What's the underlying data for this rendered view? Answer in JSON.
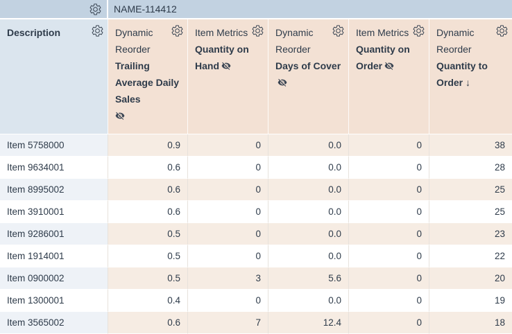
{
  "group_header": {
    "name_label": "NAME-114412"
  },
  "columns": [
    {
      "group": "",
      "label": "Description"
    },
    {
      "group": "Dynamic Reorder",
      "label": "Trailing Average Daily Sales"
    },
    {
      "group": "Item Metrics",
      "label": "Quantity on Hand"
    },
    {
      "group": "Dynamic Reorder",
      "label": "Days of Cover"
    },
    {
      "group": "Item Metrics",
      "label": "Quantity on Order"
    },
    {
      "group": "Dynamic Reorder",
      "label": "Quantity to Order",
      "sort": "↓"
    }
  ],
  "icons": {
    "gear": "settings cog (outline)",
    "visibility-off": "hidden column eye with slash",
    "sort-descending": "↓"
  },
  "rows": [
    {
      "description": "Item 5758000",
      "values": [
        "0.9",
        "0",
        "0.0",
        "0",
        "38"
      ]
    },
    {
      "description": "Item 9634001",
      "values": [
        "0.6",
        "0",
        "0.0",
        "0",
        "28"
      ]
    },
    {
      "description": "Item 8995002",
      "values": [
        "0.6",
        "0",
        "0.0",
        "0",
        "25"
      ]
    },
    {
      "description": "Item 3910001",
      "values": [
        "0.6",
        "0",
        "0.0",
        "0",
        "25"
      ]
    },
    {
      "description": "Item 9286001",
      "values": [
        "0.5",
        "0",
        "0.0",
        "0",
        "23"
      ]
    },
    {
      "description": "Item 1914001",
      "values": [
        "0.5",
        "0",
        "0.0",
        "0",
        "22"
      ]
    },
    {
      "description": "Item 0900002",
      "values": [
        "0.5",
        "3",
        "5.6",
        "0",
        "20"
      ]
    },
    {
      "description": "Item 1300001",
      "values": [
        "0.4",
        "0",
        "0.0",
        "0",
        "19"
      ]
    },
    {
      "description": "Item 3565002",
      "values": [
        "0.6",
        "7",
        "12.4",
        "0",
        "18"
      ]
    }
  ],
  "colors": {
    "group_header_bg": "#c2d2e1",
    "description_header_bg": "#dbe5ee",
    "metric_header_bg": "#f3e1d4",
    "stripe_description_bg": "#eef2f7",
    "stripe_metric_bg": "#f6ece3",
    "row_white_bg": "#ffffff",
    "text": "#2e3b4a"
  }
}
